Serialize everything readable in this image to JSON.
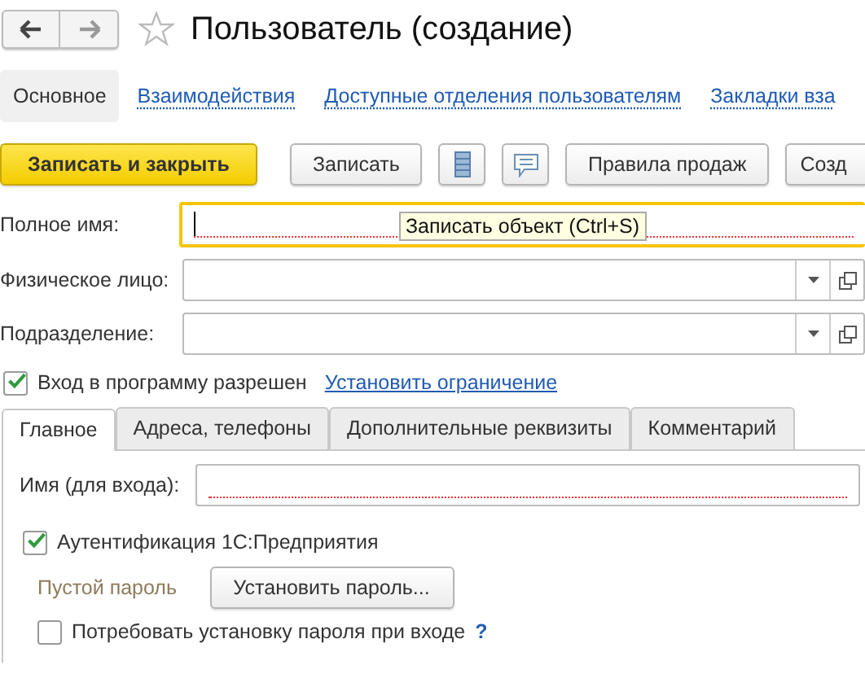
{
  "window": {
    "title": "Пользователь (создание)",
    "favorite": false
  },
  "sections": [
    {
      "label": "Основное",
      "selected": true
    },
    {
      "label": "Взаимодействия",
      "selected": false
    },
    {
      "label": "Доступные отделения пользователям",
      "selected": false
    },
    {
      "label": "Закладки вза",
      "selected": false
    }
  ],
  "toolbar": [
    {
      "kind": "primary",
      "label": "Записать и закрыть"
    },
    {
      "kind": "button",
      "label": "Записать"
    },
    {
      "kind": "list-icon"
    },
    {
      "kind": "comment-icon"
    },
    {
      "kind": "button",
      "label": "Правила продаж"
    },
    {
      "kind": "cut",
      "label": "Созд"
    }
  ],
  "tooltip": "Записать объект (Ctrl+S)",
  "fields": [
    {
      "label": "Полное имя:",
      "kind": "text",
      "focused": true,
      "required": true
    },
    {
      "label": "Физическое лицо:",
      "kind": "select",
      "focused": false,
      "required": false
    },
    {
      "label": "Подразделение:",
      "kind": "select",
      "focused": false,
      "required": false
    }
  ],
  "login_allowed": {
    "label": "Вход в программу разрешен",
    "checked": true,
    "link": "Установить ограничение"
  },
  "tabs": [
    {
      "label": "Главное",
      "selected": true
    },
    {
      "label": "Адреса, телефоны",
      "selected": false
    },
    {
      "label": "Дополнительные реквизиты",
      "selected": false
    },
    {
      "label": "Комментарий",
      "selected": false
    }
  ],
  "login_name": {
    "label": "Имя (для входа):",
    "required": true
  },
  "auth": {
    "label": "Аутентификация 1С:Предприятия",
    "checked": true
  },
  "password": {
    "status": "Пустой пароль",
    "button": "Установить пароль..."
  },
  "require_password": {
    "label": "Потребовать установку пароля при входе",
    "checked": false,
    "help": "?"
  }
}
